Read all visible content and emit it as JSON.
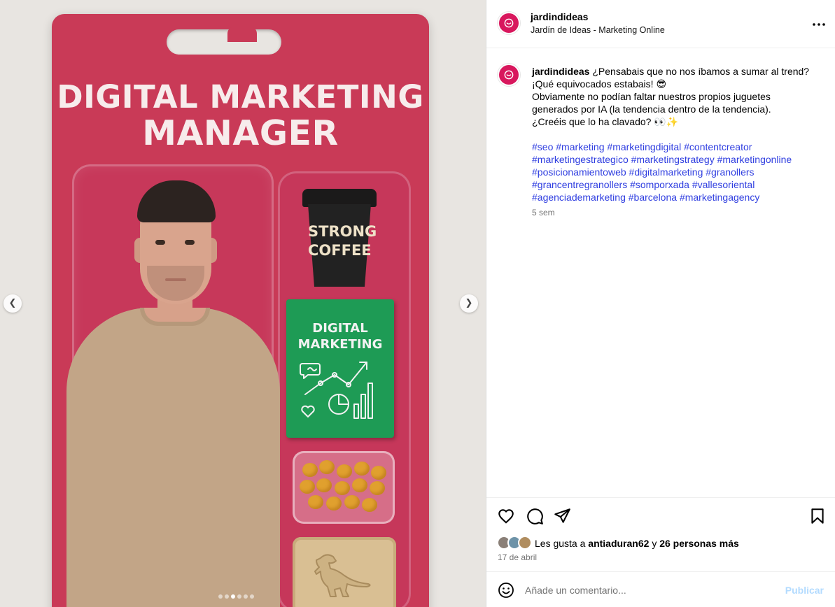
{
  "media": {
    "card_title_line1": "DIGITAL MARKETING",
    "card_title_line2": "MANAGER",
    "cup_text_line1": "STRONG",
    "cup_text_line2": "COFFEE",
    "book_text_line1": "DIGITAL",
    "book_text_line2": "MARKETING",
    "carousel": {
      "slide_count": 6,
      "active_index": 2
    },
    "prev_icon": "chevron-left-icon",
    "next_icon": "chevron-right-icon"
  },
  "header": {
    "username": "jardindideas",
    "subtitle": "Jardín de Ideas - Marketing Online",
    "more_icon": "more-horizontal-icon"
  },
  "caption": {
    "username": "jardindideas",
    "line1": "¿Pensabais que no nos íbamos a sumar al trend?",
    "line2": "¡Qué equivocados estabais! 😎",
    "line3": "Obviamente no podían faltar nuestros propios juguetes generados por IA (la tendencia dentro de la tendencia).",
    "line4": "¿Creéis que lo ha clavado? 👀✨",
    "hashtags": [
      "#seo",
      "#marketing",
      "#marketingdigital",
      "#contentcreator",
      "#marketingestrategico",
      "#marketingstrategy",
      "#marketingonline",
      "#posicionamientoweb",
      "#digitalmarketing",
      "#granollers",
      "#grancentregranollers",
      "#somporxada",
      "#vallesoriental",
      "#agenciademarketing",
      "#barcelona",
      "#marketingagency"
    ],
    "time": "5 sem"
  },
  "actions": {
    "like_icon": "heart-icon",
    "comment_icon": "comment-icon",
    "share_icon": "send-icon",
    "save_icon": "bookmark-icon"
  },
  "likes": {
    "prefix": "Les gusta a",
    "user": "antiaduran62",
    "connector": "y",
    "others": "26 personas más"
  },
  "date": "17 de abril",
  "comment": {
    "placeholder": "Añade un comentario...",
    "publish_label": "Publicar",
    "emoji_icon": "smiley-icon"
  },
  "colors": {
    "brand": "#d8175d",
    "hashtag": "#2f3ee0",
    "publish_disabled": "#b3dbff",
    "card": "#c93a57"
  }
}
